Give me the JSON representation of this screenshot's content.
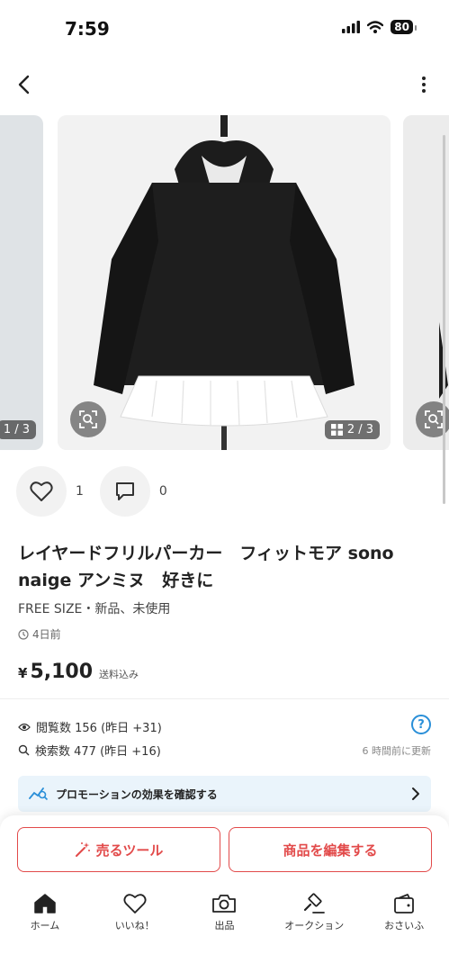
{
  "status_bar": {
    "time": "7:59",
    "battery": "80"
  },
  "carousel": {
    "prev_counter": "1 / 3",
    "main_counter": "2 / 3"
  },
  "social": {
    "likes": "1",
    "comments": "0"
  },
  "item": {
    "title": "レイヤードフリルパーカー　フィットモア sono naige アンミヌ　好きに",
    "condition": "FREE SIZE・新品、未使用",
    "posted": "4日前",
    "price_symbol": "¥",
    "price": "5,100",
    "shipping": "送料込み"
  },
  "stats": {
    "views": "閲覧数  156 (昨日 +31)",
    "searches": "検索数  477 (昨日 +16)",
    "help": "?",
    "updated": "6 時間前に更新"
  },
  "promo": {
    "label": "プロモーションの効果を確認する"
  },
  "buttons": {
    "sell_tool": "売るツール",
    "edit_item": "商品を編集する"
  },
  "tabbar": [
    {
      "label": "ホーム",
      "icon": "home-icon"
    },
    {
      "label": "いいね！",
      "icon": "heart-icon"
    },
    {
      "label": "出品",
      "icon": "camera-icon"
    },
    {
      "label": "オークション",
      "icon": "auction-icon"
    },
    {
      "label": "おさいふ",
      "icon": "wallet-icon"
    }
  ],
  "colors": {
    "accent_red": "#e24a4a",
    "link_blue": "#2a8fd8",
    "promo_bg": "#eaf4fb"
  }
}
